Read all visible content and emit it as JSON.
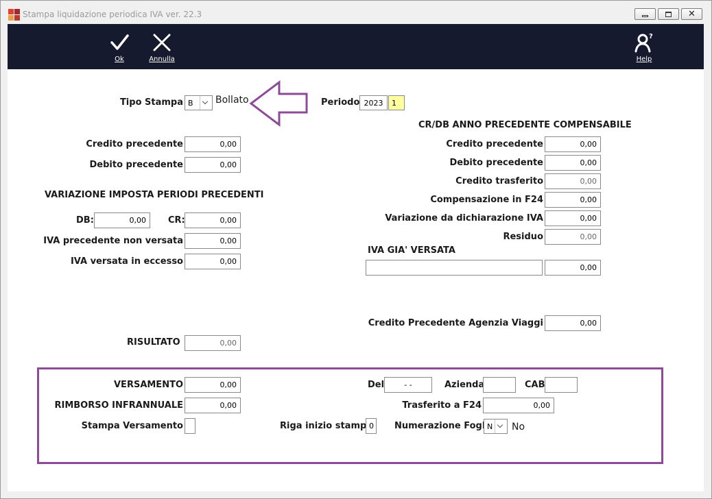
{
  "window": {
    "title": "Stampa liquidazione periodica IVA  ver. 22.3",
    "icon_colors": [
      "#e0412c",
      "#a0282e",
      "#e8a04a",
      "#c0392b"
    ]
  },
  "toolbar": {
    "ok_label": "Ok",
    "cancel_label": "Annulla",
    "help_label": "Help"
  },
  "header": {
    "tipo_stampa_label": "Tipo Stampa",
    "tipo_stampa_value": "B",
    "tipo_stampa_desc": "Bollato",
    "periodo_label": "Periodo",
    "periodo_year": "2023",
    "periodo_num": "1"
  },
  "left": {
    "credito_precedente_label": "Credito precedente",
    "credito_precedente_value": "0,00",
    "debito_precedente_label": "Debito precedente",
    "debito_precedente_value": "0,00",
    "variazione_title": "VARIAZIONE IMPOSTA PERIODI PRECEDENTI",
    "db_label": "DB:",
    "db_value": "0,00",
    "cr_label": "CR:",
    "cr_value": "0,00",
    "iva_non_versata_label": "IVA precedente non versata",
    "iva_non_versata_value": "0,00",
    "iva_eccesso_label": "IVA versata in eccesso",
    "iva_eccesso_value": "0,00",
    "risultato_label": "RISULTATO",
    "risultato_value": "0,00"
  },
  "right": {
    "section_title": "CR/DB ANNO PRECEDENTE COMPENSABILE",
    "credito_precedente_label": "Credito precedente",
    "credito_precedente_value": "0,00",
    "debito_precedente_label": "Debito precedente",
    "debito_precedente_value": "0,00",
    "credito_trasferito_label": "Credito trasferito",
    "credito_trasferito_value": "0,00",
    "compensazione_label": "Compensazione in F24",
    "compensazione_value": "0,00",
    "variazione_label": "Variazione  da dichiarazione IVA",
    "variazione_value": "0,00",
    "residuo_label": "Residuo",
    "residuo_value": "0,00",
    "iva_gia_versata_title": "IVA GIA' VERSATA",
    "iva_gia_versata_text": "",
    "iva_gia_versata_value": "0,00",
    "agenzia_viaggi_label": "Credito Precedente Agenzia Viaggi",
    "agenzia_viaggi_value": "0,00"
  },
  "bottom": {
    "versamento_label": "VERSAMENTO",
    "versamento_value": "0,00",
    "rimborso_label": "RIMBORSO INFRANNUALE",
    "rimborso_value": "0,00",
    "stampa_versamento_label": "Stampa Versamento",
    "stampa_versamento_value": "",
    "del_label": "Del",
    "del_value": "- -",
    "azienda_label": "Azienda",
    "azienda_value": "",
    "cab_label": "CAB",
    "cab_value": "",
    "trasferito_label": "Trasferito a F24",
    "trasferito_value": "0,00",
    "riga_label": "Riga inizio stampa",
    "riga_value": "0",
    "numerazione_label": "Numerazione Fogli",
    "numerazione_value": "N",
    "numerazione_desc": "No"
  },
  "annotations": {
    "highlight_color": "#8e4a99"
  }
}
